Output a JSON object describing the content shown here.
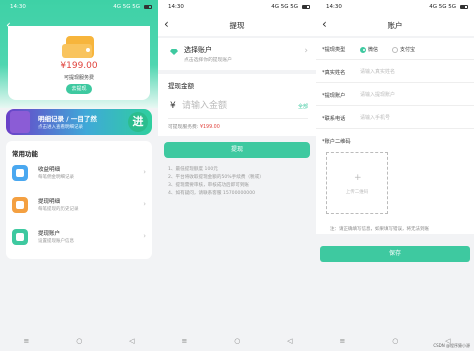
{
  "status_time": "14:30",
  "status_right": "4G 5G 5G",
  "screen1": {
    "amount": "¥199.00",
    "amount_label": "可提现服务费",
    "withdraw_btn": "去提现",
    "banner_title": "明细记录 / 一目了然",
    "banner_sub": "点击进入查看明细记录",
    "banner_go": "进",
    "func_title": "常用功能",
    "items": [
      {
        "title": "收益明细",
        "sub": "每笔佣金明细记录",
        "color": "#4aa8f0"
      },
      {
        "title": "提现明细",
        "sub": "每笔提现的历史记录",
        "color": "#f4a041"
      },
      {
        "title": "提现账户",
        "sub": "设置提现账户信息",
        "color": "#3ec9a0"
      }
    ]
  },
  "screen2": {
    "title": "提现",
    "account_title": "选择账户",
    "account_sub": "点击选择你的提现账户",
    "amount_label": "提现金额",
    "yen": "¥",
    "amount_placeholder": "请输入金额",
    "all_link": "全部",
    "avail_prefix": "可提现服务费:",
    "avail_value": "¥199.00",
    "submit": "提现",
    "notes": [
      {
        "text": "1、最低提现额度 100元"
      },
      {
        "text": "2、平台将收取提现金额的50%手续费（税或）"
      },
      {
        "text": "3、提现需要审核，审核成功后即可到账"
      },
      {
        "text": "4、如有疑问，请联系客服 15700000000"
      }
    ]
  },
  "screen3": {
    "title": "账户",
    "type_label": "*提现类型",
    "opt_wechat": "微信",
    "opt_alipay": "支付宝",
    "fields": [
      {
        "label": "*真实姓名",
        "placeholder": "请输入真实姓名"
      },
      {
        "label": "*提现账户",
        "placeholder": "请输入提现账户"
      },
      {
        "label": "*联系电话",
        "placeholder": "请输入手机号"
      }
    ],
    "qr_label": "*账户二维码",
    "upload_plus": "+",
    "upload_text": "上传二维码",
    "note": "注：请正确填写信息，如果填写错误，将无法到账",
    "save": "保存"
  },
  "sysnav": [
    "≡",
    "○",
    "◁"
  ],
  "watermark": "CSDN @程序猿小源"
}
